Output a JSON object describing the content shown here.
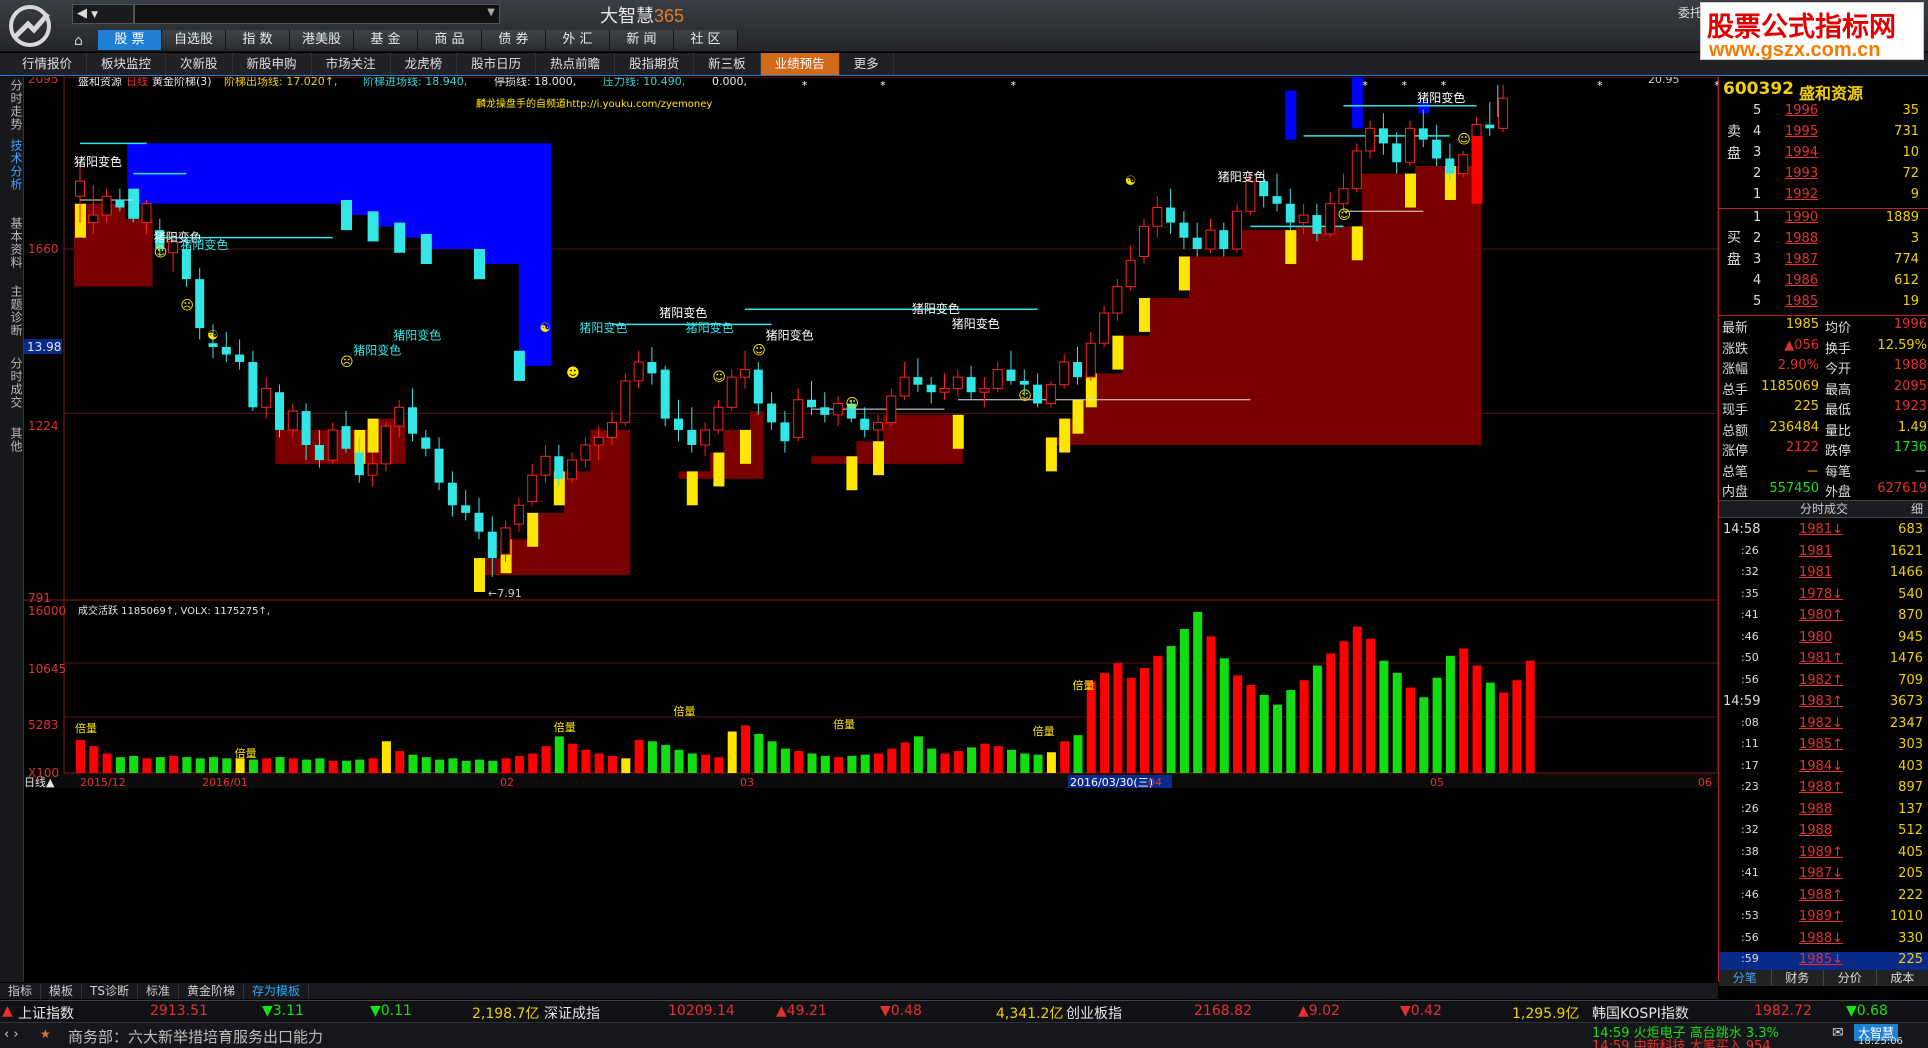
{
  "app": {
    "title_a": "大智慧",
    "title_b": "365",
    "nav_back": "◀",
    "nav_fwd": "▼",
    "entrust": "委托"
  },
  "watermark": {
    "line1": "股票公式指标网",
    "line2": "www.gszx.com.cn"
  },
  "menu": [
    "股 票",
    "自选股",
    "指 数",
    "港美股",
    "基 金",
    "商 品",
    "债 券",
    "外 汇",
    "新 闻",
    "社 区"
  ],
  "tabs2": [
    "行情报价",
    "板块监控",
    "次新股",
    "新股申购",
    "市场关注",
    "龙虎榜",
    "股市日历",
    "热点前瞻",
    "股指期货",
    "新三板",
    "业绩预告",
    "更多"
  ],
  "vtabs": [
    "分时走势",
    "技术分析",
    "基本资料",
    "主题诊断",
    "分时成交",
    "其他"
  ],
  "chart": {
    "header": {
      "name": "盛和资源",
      "period": "日线",
      "indicator": "黄金阶梯(3)",
      "items": [
        {
          "k": "阶梯出场线:",
          "v": "17.020",
          "arrow": "↑",
          "c": "#f0d000"
        },
        {
          "k": "阶梯进场线:",
          "v": "18.940",
          "arrow": "",
          "c": "#33d6d6"
        },
        {
          "k": "停损线:",
          "v": "18.000",
          "arrow": "",
          "c": "#e6e6e6"
        },
        {
          "k": "压力线:",
          "v": "10.490",
          "arrow": "",
          "c": "#33d6d6"
        },
        {
          "k": "",
          "v": "0.000",
          "arrow": "",
          "c": "#e6e6e6"
        }
      ],
      "link": "麟龙操盘手的自频道http://i.youku.com/zyemoney"
    },
    "y_labels": [
      "2095",
      "1660",
      "1224",
      "791"
    ],
    "y_tag": "13.98",
    "max_label": "20.95",
    "min_label": "7.91",
    "annotation": "猪阳变色",
    "vol_header": "成交活跃  1185069↑, VOLX: 1175275↑,",
    "vol_y_labels": [
      "16000",
      "10645",
      "5283",
      "X100"
    ],
    "vol_tags": [
      "倍量",
      "倍量",
      "倍量",
      "倍量",
      "倍量",
      "倍量",
      "倍量"
    ],
    "date_labels": [
      "日线▲",
      "2015/12",
      "2016/01",
      "02",
      "03",
      "2016/03/30(三)",
      "04",
      "05",
      "06"
    ]
  },
  "quote": {
    "code": "600392",
    "name": "盛和资源",
    "sell_label": "卖盘",
    "buy_label": "买盘",
    "sell": [
      {
        "i": "5",
        "p": "1996",
        "v": "35"
      },
      {
        "i": "4",
        "p": "1995",
        "v": "731"
      },
      {
        "i": "3",
        "p": "1994",
        "v": "10"
      },
      {
        "i": "2",
        "p": "1993",
        "v": "72"
      },
      {
        "i": "1",
        "p": "1992",
        "v": "9"
      }
    ],
    "buy": [
      {
        "i": "1",
        "p": "1990",
        "v": "1889"
      },
      {
        "i": "2",
        "p": "1988",
        "v": "3"
      },
      {
        "i": "3",
        "p": "1987",
        "v": "774"
      },
      {
        "i": "4",
        "p": "1986",
        "v": "612"
      },
      {
        "i": "5",
        "p": "1985",
        "v": "19"
      }
    ],
    "stats": [
      {
        "k1": "最新",
        "v1": "1985",
        "k2": "均价",
        "v2": "1996"
      },
      {
        "k1": "涨跌",
        "v1": "▲056",
        "k2": "换手",
        "v2": "12.59%"
      },
      {
        "k1": "涨幅",
        "v1": "2.90%",
        "k2": "今开",
        "v2": "1988"
      },
      {
        "k1": "总手",
        "v1": "1185069",
        "k2": "最高",
        "v2": "2095"
      },
      {
        "k1": "现手",
        "v1": "225",
        "k2": "最低",
        "v2": "1923"
      },
      {
        "k1": "总额",
        "v1": "236484",
        "k2": "量比",
        "v2": "1.49"
      },
      {
        "k1": "涨停",
        "v1": "2122",
        "k2": "跌停",
        "v2": "1736"
      },
      {
        "k1": "总笔",
        "v1": "－",
        "k2": "每笔",
        "v2": "－"
      },
      {
        "k1": "内盘",
        "v1": "557450",
        "k2": "外盘",
        "v2": "627619"
      }
    ],
    "trades_title": "分时成交",
    "trades_close": "细",
    "trades": [
      {
        "t": "14:58",
        "p": "1981↓",
        "v": "683",
        "c": "red"
      },
      {
        "t": ":26",
        "p": "1981",
        "v": "1621",
        "c": "red"
      },
      {
        "t": ":32",
        "p": "1981",
        "v": "1466",
        "c": "red"
      },
      {
        "t": ":35",
        "p": "1978↓",
        "v": "540",
        "c": "red"
      },
      {
        "t": ":41",
        "p": "1980↑",
        "v": "870",
        "c": "red"
      },
      {
        "t": ":46",
        "p": "1980",
        "v": "945",
        "c": "red"
      },
      {
        "t": ":50",
        "p": "1981↑",
        "v": "1476",
        "c": "red"
      },
      {
        "t": ":56",
        "p": "1982↑",
        "v": "709",
        "c": "red"
      },
      {
        "t": "14:59",
        "p": "1983↑",
        "v": "3673",
        "c": "red"
      },
      {
        "t": ":08",
        "p": "1982↓",
        "v": "2347",
        "c": "red"
      },
      {
        "t": ":11",
        "p": "1985↑",
        "v": "303",
        "c": "red"
      },
      {
        "t": ":17",
        "p": "1984↓",
        "v": "403",
        "c": "red"
      },
      {
        "t": ":23",
        "p": "1988↑",
        "v": "897",
        "c": "red"
      },
      {
        "t": ":26",
        "p": "1988",
        "v": "137",
        "c": "red"
      },
      {
        "t": ":32",
        "p": "1988",
        "v": "512",
        "c": "red"
      },
      {
        "t": ":38",
        "p": "1989↑",
        "v": "405",
        "c": "red"
      },
      {
        "t": ":41",
        "p": "1987↓",
        "v": "205",
        "c": "red"
      },
      {
        "t": ":46",
        "p": "1988↑",
        "v": "222",
        "c": "red"
      },
      {
        "t": ":53",
        "p": "1989↑",
        "v": "1010",
        "c": "red"
      },
      {
        "t": ":56",
        "p": "1988↓",
        "v": "330",
        "c": "red"
      },
      {
        "t": ":59",
        "p": "1985↓",
        "v": "225",
        "c": "red"
      }
    ],
    "foot": [
      "分笔",
      "财务",
      "分价",
      "成本"
    ]
  },
  "subtabs": [
    "指标",
    "模板",
    "TS诊断",
    "标准",
    "黄金阶梯",
    "存为模板"
  ],
  "ticker": {
    "sh_name": "上证指数",
    "sh_val": "2913.51",
    "sh_chg": "▼3.11",
    "sh_pct": "▼0.11",
    "sh_amt": "2,198.7亿",
    "sz_name": "深证成指",
    "sz_val": "10209.14",
    "sz_chg": "▲49.21",
    "sz_pct": "▼0.48",
    "sz_amt": "4,341.2亿",
    "cy_name": "创业板指",
    "cy_val": "2168.82",
    "cy_chg": "▲9.02",
    "cy_pct": "▼0.42",
    "cy_amt": "1,295.9亿",
    "kr_name": "韩国KOSPI指数",
    "kr_val": "1982.72",
    "kr_pct": "▼0.68"
  },
  "news": {
    "text": "商务部：六大新举措培育服务出口能力",
    "alert1": "14:59 火炬电子 高台跳水 3.3%",
    "alert2": "14:59 中新科技 大笔买入 954",
    "time": "18:25:06",
    "brand": "大智慧"
  },
  "chart_data": {
    "type": "candlestick",
    "candles": [
      [
        18.0,
        18.9,
        17.3,
        18.4
      ],
      [
        17.3,
        18.3,
        17.0,
        17.5
      ],
      [
        17.5,
        18.2,
        17.3,
        18.0
      ],
      [
        17.9,
        18.2,
        17.6,
        17.7
      ],
      [
        17.7,
        18.0,
        17.3,
        17.5
      ],
      [
        17.3,
        17.9,
        17.0,
        17.8
      ],
      [
        17.1,
        17.4,
        16.4,
        16.6
      ],
      [
        16.5,
        17.0,
        16.0,
        16.8
      ],
      [
        16.6,
        16.8,
        15.6,
        15.8
      ],
      [
        15.8,
        16.1,
        14.2,
        14.5
      ],
      [
        14.1,
        14.6,
        13.7,
        14.0
      ],
      [
        14.0,
        14.4,
        13.6,
        13.8
      ],
      [
        13.8,
        14.2,
        13.4,
        13.6
      ],
      [
        13.6,
        13.9,
        12.3,
        12.4
      ],
      [
        12.4,
        13.2,
        12.1,
        12.9
      ],
      [
        12.8,
        13.0,
        11.6,
        11.8
      ],
      [
        11.8,
        12.5,
        11.6,
        12.3
      ],
      [
        12.3,
        12.5,
        11.0,
        11.4
      ],
      [
        11.4,
        11.8,
        10.8,
        11.0
      ],
      [
        11.0,
        12.0,
        10.9,
        11.8
      ],
      [
        11.9,
        12.3,
        11.2,
        11.3
      ],
      [
        11.2,
        11.6,
        10.4,
        10.6
      ],
      [
        10.6,
        11.2,
        10.3,
        10.9
      ],
      [
        10.9,
        12.0,
        10.7,
        11.9
      ],
      [
        11.9,
        12.6,
        11.6,
        12.4
      ],
      [
        12.4,
        12.9,
        11.5,
        11.7
      ],
      [
        11.6,
        11.8,
        11.1,
        11.3
      ],
      [
        11.3,
        11.6,
        10.2,
        10.4
      ],
      [
        10.4,
        10.7,
        9.5,
        9.8
      ],
      [
        9.8,
        10.2,
        9.4,
        9.6
      ],
      [
        9.6,
        10.0,
        8.9,
        9.1
      ],
      [
        9.1,
        9.5,
        7.9,
        8.4
      ],
      [
        8.5,
        9.4,
        8.3,
        9.2
      ],
      [
        9.3,
        10.0,
        9.1,
        9.8
      ],
      [
        9.9,
        10.9,
        9.8,
        10.6
      ],
      [
        10.6,
        11.4,
        10.4,
        11.1
      ],
      [
        11.1,
        11.4,
        10.3,
        10.5
      ],
      [
        10.5,
        11.2,
        10.4,
        11.0
      ],
      [
        11.0,
        11.6,
        10.8,
        11.4
      ],
      [
        11.4,
        11.9,
        11.0,
        11.6
      ],
      [
        11.6,
        12.3,
        11.4,
        12.0
      ],
      [
        12.0,
        13.3,
        11.9,
        13.1
      ],
      [
        13.1,
        13.9,
        12.9,
        13.6
      ],
      [
        13.6,
        14.0,
        13.0,
        13.3
      ],
      [
        13.4,
        13.5,
        11.9,
        12.1
      ],
      [
        12.1,
        12.6,
        11.5,
        11.8
      ],
      [
        11.8,
        12.4,
        11.2,
        11.4
      ],
      [
        11.4,
        12.0,
        11.1,
        11.8
      ],
      [
        11.8,
        12.6,
        11.7,
        12.4
      ],
      [
        12.4,
        13.4,
        12.3,
        13.2
      ],
      [
        13.2,
        13.9,
        12.9,
        13.4
      ],
      [
        13.4,
        13.6,
        12.2,
        12.5
      ],
      [
        12.5,
        12.8,
        11.8,
        12.0
      ],
      [
        12.0,
        12.3,
        11.2,
        11.5
      ],
      [
        11.6,
        12.9,
        11.5,
        12.6
      ],
      [
        12.6,
        13.1,
        12.2,
        12.4
      ],
      [
        12.4,
        12.8,
        12.0,
        12.2
      ],
      [
        12.2,
        12.7,
        11.9,
        12.5
      ],
      [
        12.5,
        12.6,
        12.0,
        12.1
      ],
      [
        12.1,
        12.4,
        11.6,
        11.8
      ],
      [
        11.8,
        12.2,
        11.5,
        12.0
      ],
      [
        12.0,
        12.9,
        11.9,
        12.7
      ],
      [
        12.7,
        13.6,
        12.6,
        13.2
      ],
      [
        13.2,
        13.7,
        12.8,
        13.0
      ],
      [
        13.0,
        13.2,
        12.5,
        12.8
      ],
      [
        12.8,
        13.3,
        12.6,
        12.9
      ],
      [
        12.9,
        13.4,
        12.7,
        13.2
      ],
      [
        13.2,
        13.5,
        12.6,
        12.8
      ],
      [
        12.8,
        13.2,
        12.4,
        12.9
      ],
      [
        12.9,
        13.6,
        12.8,
        13.4
      ],
      [
        13.4,
        13.9,
        13.0,
        13.1
      ],
      [
        13.1,
        13.4,
        12.7,
        13.0
      ],
      [
        13.0,
        13.3,
        12.4,
        12.5
      ],
      [
        12.5,
        13.1,
        12.4,
        13.0
      ],
      [
        13.0,
        13.8,
        12.9,
        13.6
      ],
      [
        13.6,
        14.0,
        13.0,
        13.2
      ],
      [
        13.2,
        14.4,
        13.1,
        14.1
      ],
      [
        14.1,
        15.1,
        14.0,
        14.9
      ],
      [
        14.9,
        15.8,
        14.7,
        15.6
      ],
      [
        15.6,
        16.7,
        15.5,
        16.3
      ],
      [
        16.4,
        17.4,
        16.2,
        17.2
      ],
      [
        17.2,
        18.0,
        16.9,
        17.7
      ],
      [
        17.7,
        18.2,
        17.0,
        17.3
      ],
      [
        17.3,
        17.6,
        16.6,
        16.9
      ],
      [
        16.9,
        17.3,
        16.4,
        16.6
      ],
      [
        16.6,
        17.4,
        16.5,
        17.1
      ],
      [
        17.1,
        17.3,
        16.4,
        16.6
      ],
      [
        16.6,
        17.8,
        16.5,
        17.6
      ],
      [
        17.6,
        18.6,
        17.5,
        18.4
      ],
      [
        18.4,
        18.7,
        17.7,
        18.0
      ],
      [
        18.0,
        18.6,
        17.6,
        17.8
      ],
      [
        17.8,
        18.2,
        17.1,
        17.3
      ],
      [
        17.3,
        17.8,
        17.0,
        17.5
      ],
      [
        17.5,
        17.8,
        16.8,
        17.0
      ],
      [
        17.0,
        18.1,
        16.9,
        17.8
      ],
      [
        17.8,
        18.6,
        17.6,
        18.2
      ],
      [
        18.2,
        19.4,
        18.1,
        19.2
      ],
      [
        19.2,
        20.0,
        19.0,
        19.8
      ],
      [
        19.8,
        20.2,
        19.1,
        19.4
      ],
      [
        19.4,
        19.7,
        18.6,
        18.9
      ],
      [
        18.9,
        20.0,
        18.8,
        19.8
      ],
      [
        19.8,
        20.3,
        19.3,
        19.5
      ],
      [
        19.5,
        19.9,
        18.8,
        19.0
      ],
      [
        19.0,
        19.4,
        18.4,
        18.6
      ],
      [
        18.6,
        19.2,
        18.5,
        19.1
      ],
      [
        19.1,
        20.1,
        19.0,
        19.9
      ],
      [
        19.9,
        20.5,
        19.6,
        19.8
      ],
      [
        19.8,
        20.95,
        19.7,
        20.6
      ]
    ],
    "volumes": [
      2.7,
      2.2,
      1.6,
      1.3,
      1.4,
      1.2,
      1.3,
      1.4,
      1.3,
      1.2,
      1.3,
      1.2,
      1.2,
      1.1,
      1.2,
      1.3,
      1.2,
      1.1,
      1.2,
      1.0,
      1.0,
      1.1,
      1.2,
      2.6,
      1.8,
      1.5,
      1.3,
      1.1,
      1.2,
      1.0,
      1.1,
      1.0,
      1.2,
      1.4,
      1.6,
      2.2,
      3.0,
      2.4,
      1.9,
      1.6,
      1.4,
      1.2,
      2.7,
      2.6,
      2.3,
      1.9,
      1.6,
      1.5,
      1.3,
      3.4,
      3.9,
      3.2,
      2.6,
      2.0,
      1.8,
      1.6,
      1.4,
      1.3,
      1.4,
      1.5,
      1.6,
      2.0,
      2.5,
      3.0,
      2.0,
      1.6,
      1.8,
      2.1,
      2.4,
      2.2,
      1.9,
      1.6,
      1.5,
      1.7,
      2.6,
      3.1,
      7.5,
      8.2,
      9.0,
      7.8,
      8.6,
      9.6,
      10.4,
      11.8,
      13.2,
      11.2,
      9.4,
      8.0,
      7.2,
      6.4,
      5.6,
      6.8,
      7.6,
      8.8,
      9.8,
      10.8,
      12.0,
      11.0,
      9.2,
      8.2,
      7.0,
      6.2,
      7.8,
      9.6,
      10.2,
      8.8,
      7.4,
      6.6,
      7.6,
      9.2
    ]
  }
}
